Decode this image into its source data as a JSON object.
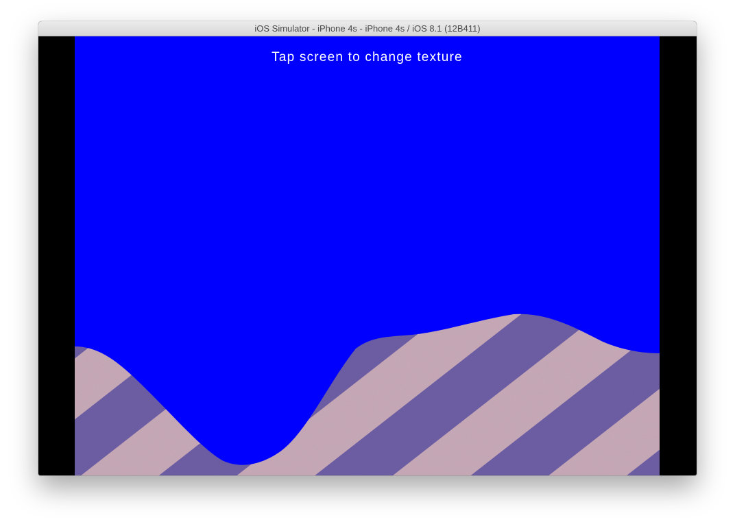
{
  "window": {
    "title": "iOS Simulator - iPhone 4s - iPhone 4s / iOS 8.1 (12B411)"
  },
  "screen": {
    "hint_text": "Tap screen to change texture",
    "colors": {
      "sky": "#0000ff",
      "stripe_light": "#c8aab8",
      "stripe_dark": "#6e5fa6",
      "letterbox": "#000000"
    },
    "terrain_texture": "diagonal-stripes-leather"
  }
}
